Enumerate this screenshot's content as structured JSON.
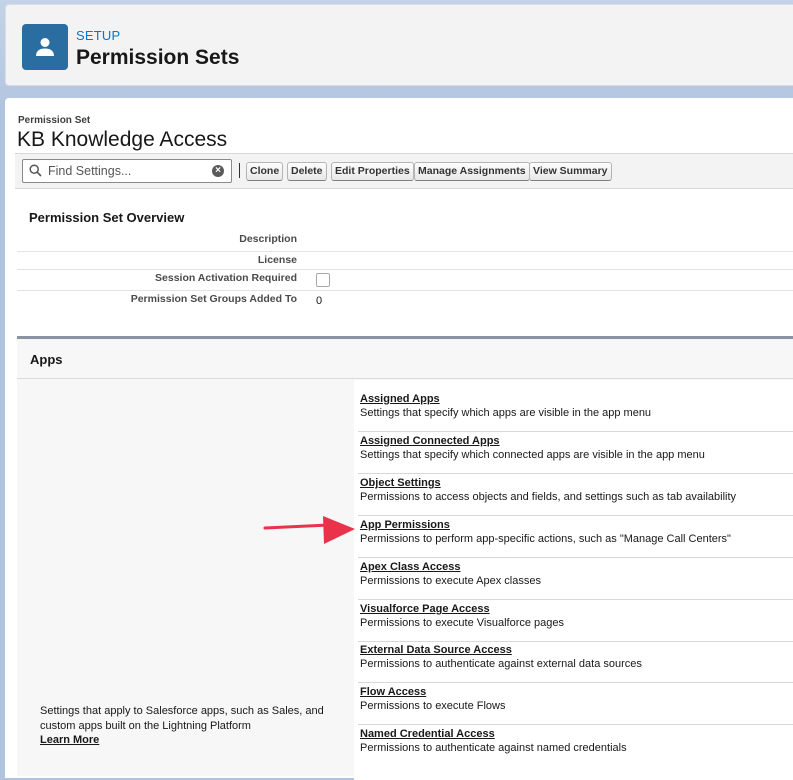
{
  "header": {
    "setup_label": "SETUP",
    "title": "Permission Sets"
  },
  "record": {
    "type_label": "Permission Set",
    "name": "KB Knowledge Access"
  },
  "toolbar": {
    "search_placeholder": "Find Settings...",
    "buttons": [
      "Clone",
      "Delete",
      "Edit Properties",
      "Manage Assignments",
      "View Summary"
    ]
  },
  "overview": {
    "title": "Permission Set Overview",
    "rows": [
      {
        "label": "Description",
        "value": ""
      },
      {
        "label": "License",
        "value": ""
      },
      {
        "label": "Session Activation Required",
        "value": ""
      },
      {
        "label": "Permission Set Groups Added To",
        "value": "0"
      }
    ]
  },
  "apps": {
    "title": "Apps",
    "description": "Settings that apply to Salesforce apps, such as Sales, and custom apps built on the Lightning Platform",
    "learn_more": "Learn More",
    "items": [
      {
        "title": "Assigned Apps",
        "desc": "Settings that specify which apps are visible in the app menu"
      },
      {
        "title": "Assigned Connected Apps",
        "desc": "Settings that specify which connected apps are visible in the app menu"
      },
      {
        "title": "Object Settings",
        "desc": "Permissions to access objects and fields, and settings such as tab availability"
      },
      {
        "title": "App Permissions",
        "desc": "Permissions to perform app-specific actions, such as \"Manage Call Centers\""
      },
      {
        "title": "Apex Class Access",
        "desc": "Permissions to execute Apex classes"
      },
      {
        "title": "Visualforce Page Access",
        "desc": "Permissions to execute Visualforce pages"
      },
      {
        "title": "External Data Source Access",
        "desc": "Permissions to authenticate against external data sources"
      },
      {
        "title": "Flow Access",
        "desc": "Permissions to execute Flows"
      },
      {
        "title": "Named Credential Access",
        "desc": "Permissions to authenticate against named credentials"
      }
    ]
  },
  "colors": {
    "brand_icon": "#2a6ea1",
    "link_blue": "#0176d3",
    "annotation_arrow": "#e8334a"
  }
}
